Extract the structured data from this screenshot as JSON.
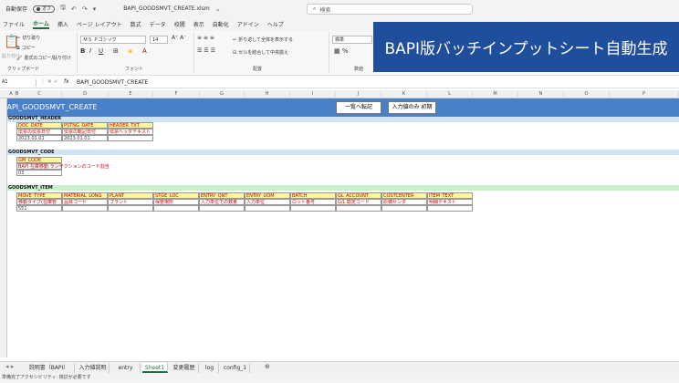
{
  "titlebar": {
    "autosave": "自動保存",
    "autosave_state": "オフ",
    "filename": "BAPI_GOODSMVT_CREATE.xlsm",
    "search_placeholder": "検索"
  },
  "menu": [
    "ファイル",
    "ホーム",
    "挿入",
    "ページ レイアウト",
    "数式",
    "データ",
    "校閲",
    "表示",
    "自動化",
    "アドイン",
    "ヘルプ"
  ],
  "menu_active": "ホーム",
  "ribbon": {
    "cut": "切り取り",
    "copy": "コピー",
    "format_painter": "書式のコピー/貼り付け",
    "paste": "貼り付け",
    "clipboard_group": "クリップボード",
    "font_name": "ＭＳ Ｐゴシック",
    "font_size": "14",
    "font_group": "フォント",
    "wrap_text": "折り返して全体を表示する",
    "merge_center": "セルを結合して中央揃え",
    "align_group": "配置",
    "number_format": "標準",
    "number_group": "数値"
  },
  "banner": "BAPI版バッチインプットシート自動生成",
  "formula": {
    "name_box": "A1",
    "fx": "fx",
    "content": "BAPI_GOODSMVT_CREATE"
  },
  "columns": [
    "A",
    "B",
    "C",
    "D",
    "E",
    "F",
    "G",
    "H",
    "I",
    "J",
    "K",
    "L",
    "M",
    "N",
    "O",
    "P"
  ],
  "sheet": {
    "title": "BAPI_GOODSMVT_CREATE",
    "btn_transfer": "一覧へ転記",
    "btn_init": "入力値のみ 初期",
    "header_section": {
      "label": "GOODSMVT_HEADER",
      "fields": [
        "DOC_DATE",
        "PSTNG_DATE",
        "HEADER_TXT"
      ],
      "descs": [
        "伝票の伝票日付",
        "伝票の転記日付",
        "伝票ヘッダテキスト"
      ],
      "values": [
        "2023.01.01",
        "2023.01.01",
        ""
      ]
    },
    "code_section": {
      "label": "GOODSMVT_CODE",
      "fields": [
        "GM_CODE"
      ],
      "descs": [
        "BAPI 在庫移動:ランザクションのコード割当"
      ],
      "values": [
        "03"
      ]
    },
    "item_section": {
      "label": "GOODSMVT_ITEM",
      "fields": [
        "MOVE_TYPE",
        "MATERIAL_LONG",
        "PLANT",
        "STGE_LOC",
        "ENTRY_QNT",
        "ENTRY_UOM",
        "BATCH",
        "GL_ACCOUNT",
        "COSTCENTER",
        "ITEM_TEXT"
      ],
      "descs": [
        "移動タイプ(在庫管",
        "品目コード",
        "プラント",
        "保管場所",
        "入力単位での数量",
        "入力単位",
        "ロット番号",
        "G/L 勘定コード",
        "原価センタ",
        "明細テキスト"
      ],
      "values": [
        "551",
        "",
        "",
        "",
        "",
        "",
        "",
        "",
        "",
        ""
      ]
    }
  },
  "tabs": [
    "説明書（BAPI）",
    "入力値説明",
    "entry",
    "Sheet1",
    "変更履歴",
    "log",
    "config_1"
  ],
  "tab_active": "Sheet1",
  "status": {
    "mode": "準備完了",
    "accessibility": "アクセシビリティ: 検討が必要です"
  },
  "colors": {
    "banner": "#1f4e9d",
    "title_bar": "#4a80c8",
    "header_band": "#cfe3f3",
    "code_band": "#cfe3f3",
    "item_band": "#c6efce",
    "field_fill": "#fff799",
    "desc_text": "#c00000"
  }
}
